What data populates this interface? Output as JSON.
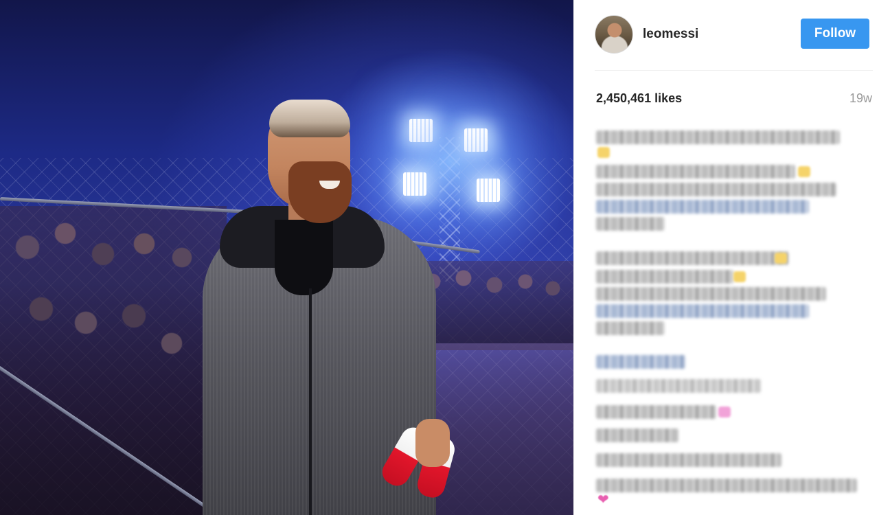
{
  "post": {
    "username": "leomessi",
    "follow_label": "Follow",
    "likes": "2,450,461 likes",
    "time_ago": "19w",
    "photo_description_icon": "photo",
    "avatar_icon": "avatar",
    "caption_blurred": true
  },
  "colors": {
    "follow_button": "#3897f0",
    "text_primary": "#262626",
    "text_secondary": "#999999"
  }
}
